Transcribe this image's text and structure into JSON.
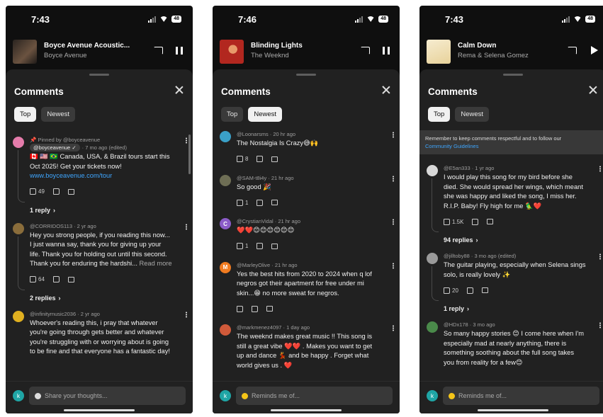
{
  "phones": [
    {
      "status_time": "7:43",
      "battery": "48",
      "player": {
        "title": "Boyce Avenue Acoustic...",
        "artist": "Boyce Avenue",
        "control": "pause-icon",
        "thumb_color": "#4a3a30"
      },
      "panel": {
        "title": "Comments",
        "chips": [
          "Top",
          "Newest"
        ],
        "active_chip": "Top"
      },
      "comments": [
        {
          "pinned": "Pinned by @boyceavenue",
          "author": "@boyceavenue",
          "meta": "· 7 mo ago (edited)",
          "lines": [
            "🇨🇦 🇺🇸 🇧🇷 Canada, USA, & Brazil tours start this",
            "Oct 2025! Get your tickets now!"
          ],
          "link": "www.boyceavenue.com/tour",
          "likes": "49",
          "replies": "1 reply",
          "avatar_color": "#e57cab"
        },
        {
          "meta": "@CORRIDOS113 · 2 yr ago",
          "lines": [
            "Hey you strong people, if you reading this now...",
            "I just wanna say, thank you for giving up your",
            "life. Thank you for holding out until this second.",
            "Thank you for enduring the hardshi..."
          ],
          "readmore": "Read more",
          "likes": "64",
          "replies": "2 replies",
          "avatar_color": "#8a6d3b"
        },
        {
          "meta": "@infinitymusic2036 · 2 yr ago",
          "lines": [
            "Whoever's reading this, i pray that whatever",
            "you're going through gets better and whatever",
            "you're struggling with or worrying about is going",
            "to be fine and that everyone has a fantastic day!"
          ],
          "avatar_color": "#e0b020"
        }
      ],
      "composer": {
        "avatar_letter": "k",
        "placeholder": "Share your thoughts..."
      }
    },
    {
      "status_time": "7:46",
      "battery": "48",
      "player": {
        "title": "Blinding Lights",
        "artist": "The Weeknd",
        "control": "pause-icon",
        "thumb_color": "#b2271f"
      },
      "panel": {
        "title": "Comments",
        "chips": [
          "Top",
          "Newest"
        ],
        "active_chip": "Newest"
      },
      "comments": [
        {
          "meta": "@Loonarsms · 20 hr ago",
          "lines": [
            "The Nostalgia Is Crazy😅🙌"
          ],
          "likes": "8",
          "avatar_color": "#3aa0c8"
        },
        {
          "meta": "@SAM-t8i4y · 21 hr ago",
          "lines": [
            "So good 🎉"
          ],
          "likes": "1",
          "avatar_color": "#6e6e55"
        },
        {
          "meta": "@CrystianVidal · 21 hr ago",
          "lines": [
            "❤️❤️😊😊😊😊😊😊"
          ],
          "likes": "1",
          "avatar_color": "#8b5cc8",
          "avatar_letter": "C"
        },
        {
          "meta": "@MarleyOlive · 21 hr ago",
          "lines": [
            "Yes the best hits from 2020 to 2024 when q lof",
            "negros got their  apartment for free under mi",
            "skin...😁 no more sweat for negros."
          ],
          "likes": "",
          "avatar_color": "#f07b20",
          "avatar_letter": "M"
        },
        {
          "meta": "@markmenez4097 · 1 day ago",
          "lines": [
            "The weeknd makes great music !! This song is",
            "still a great vibe ❤️❤️ . Makes you want to get",
            "up and dance 💃 and be happy . Forget what",
            "world gives us . ❤️"
          ],
          "avatar_color": "#d05a3a"
        }
      ],
      "composer": {
        "avatar_letter": "k",
        "placeholder": "Reminds me of..."
      }
    },
    {
      "status_time": "7:43",
      "battery": "48",
      "player": {
        "title": "Calm Down",
        "artist": "Rema & Selena Gomez",
        "control": "play-icon",
        "thumb_color": "#f0e0b0"
      },
      "panel": {
        "title": "Comments",
        "chips": [
          "Top",
          "Newest"
        ],
        "active_chip": "Top"
      },
      "notice": {
        "text": "Remember to keep comments respectful and to follow our",
        "link": "Community Guidelines"
      },
      "comments": [
        {
          "meta": "@E5an333 · 1 yr ago",
          "lines": [
            "I would play this song for my bird before she",
            "died. She would spread her wings, which meant",
            "she was happy and liked the song, I miss her.",
            "R.I.P. Baby! Fly high for me 🦜❤️"
          ],
          "likes": "1.5K",
          "replies": "94 replies",
          "avatar_color": "#d8d8d8"
        },
        {
          "meta": "@jilltoby88 · 3 mo ago (edited)",
          "lines": [
            "The guitar playing, especially when Selena sings",
            "solo, is really lovely ✨"
          ],
          "likes": "20",
          "replies": "1 reply",
          "avatar_color": "#9a9a9a"
        },
        {
          "meta": "@HDx178 · 3 mo ago",
          "lines": [
            "So many happy stories 😊 I come here when I'm",
            "especially mad at nearly anything, there is",
            "something soothing about the full song takes",
            "you from reality for a few😊"
          ],
          "avatar_color": "#4a8a4a"
        }
      ],
      "composer": {
        "avatar_letter": "k",
        "placeholder": "Reminds me of..."
      }
    }
  ]
}
